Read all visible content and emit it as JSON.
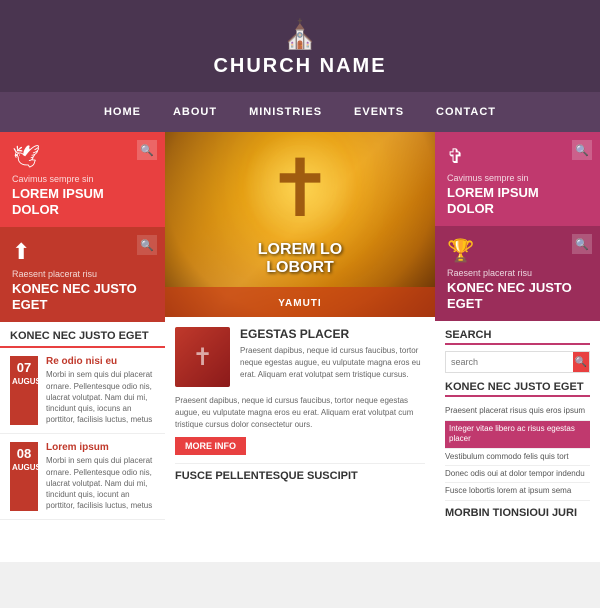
{
  "header": {
    "church_name": "CHURCH NAME",
    "icon": "⛪"
  },
  "nav": {
    "items": [
      "HOME",
      "ABOUT",
      "MINISTRIES",
      "EVENTS",
      "CONTACT"
    ]
  },
  "left_sidebar": {
    "top": {
      "subtitle": "Cavimus sempre sin",
      "title": "LOREM IPSUM DOLOR",
      "icon": "🕊"
    },
    "bottom": {
      "subtitle": "Raesent placerat risu",
      "title": "KONEC NEC JUSTO EGET",
      "icon": "⬆"
    },
    "news_section_title": "KONEC NEC JUSTO EGET",
    "news_items": [
      {
        "day": "07",
        "month": "August",
        "title": "Re odio nisi eu",
        "body": "Morbi in sem quis dui placerat ornare. Pellentesque odio nis, ulacrat volutpat. Nam dui mi, tincidunt quis, iocuns an porttitor, facilisis luctus, metus"
      },
      {
        "day": "08",
        "month": "August",
        "title": "Lorem ipsum",
        "body": "Morbi in sem quis dui placerat ornare. Pellentesque odio nis, ulacrat volutpat. Nam dui mi, tincidunt quis, iocunt an porttitor, facilisis luctus, metus"
      }
    ]
  },
  "hero": {
    "title_line1": "LOREM LO",
    "title_line2": "LOBORT",
    "overlay_text": "YAMUTI"
  },
  "center_article": {
    "title": "EGESTAS PLACER",
    "body1": "Praesent dapibus, neque id cursus faucibus, tortor neque egestas augue, eu vulputate magna eros eu erat. Aliquam erat volutpat sem tristique cursus.",
    "body2": "Praesent dapibus, neque id cursus faucibus, tortor neque egestas augue, eu vulputate magna eros eu erat. Aliquam erat volutpat cum tristique cursus dolor consectetur ours.",
    "more_info_label": "MORE INFO",
    "article2_title": "FUSCE PELLENTESQUE SUSCIPIT"
  },
  "right_sidebar": {
    "top": {
      "subtitle": "Cavimus sempre sin",
      "title": "LOREM IPSUM DOLOR",
      "icon": "✞"
    },
    "bottom": {
      "subtitle": "Raesent placerat risu",
      "title": "KONEC NEC JUSTO EGET",
      "icon": "🏆"
    },
    "search": {
      "section_title": "SEARCH",
      "placeholder": "search"
    },
    "list_section": {
      "title": "KONEC NEC JUSTO EGET",
      "items": [
        "Praesent placerat risus quis eros ipsum",
        "Integer vitae libero ac risus egestas placer",
        "Vestibulum commodo felis quis tort",
        "Donec odis oui at dolor tempor indendu",
        "Fusce lobortis lorem at ipsum sema"
      ]
    },
    "widget_title": "MORBIN TIONSIOUI JURI"
  }
}
